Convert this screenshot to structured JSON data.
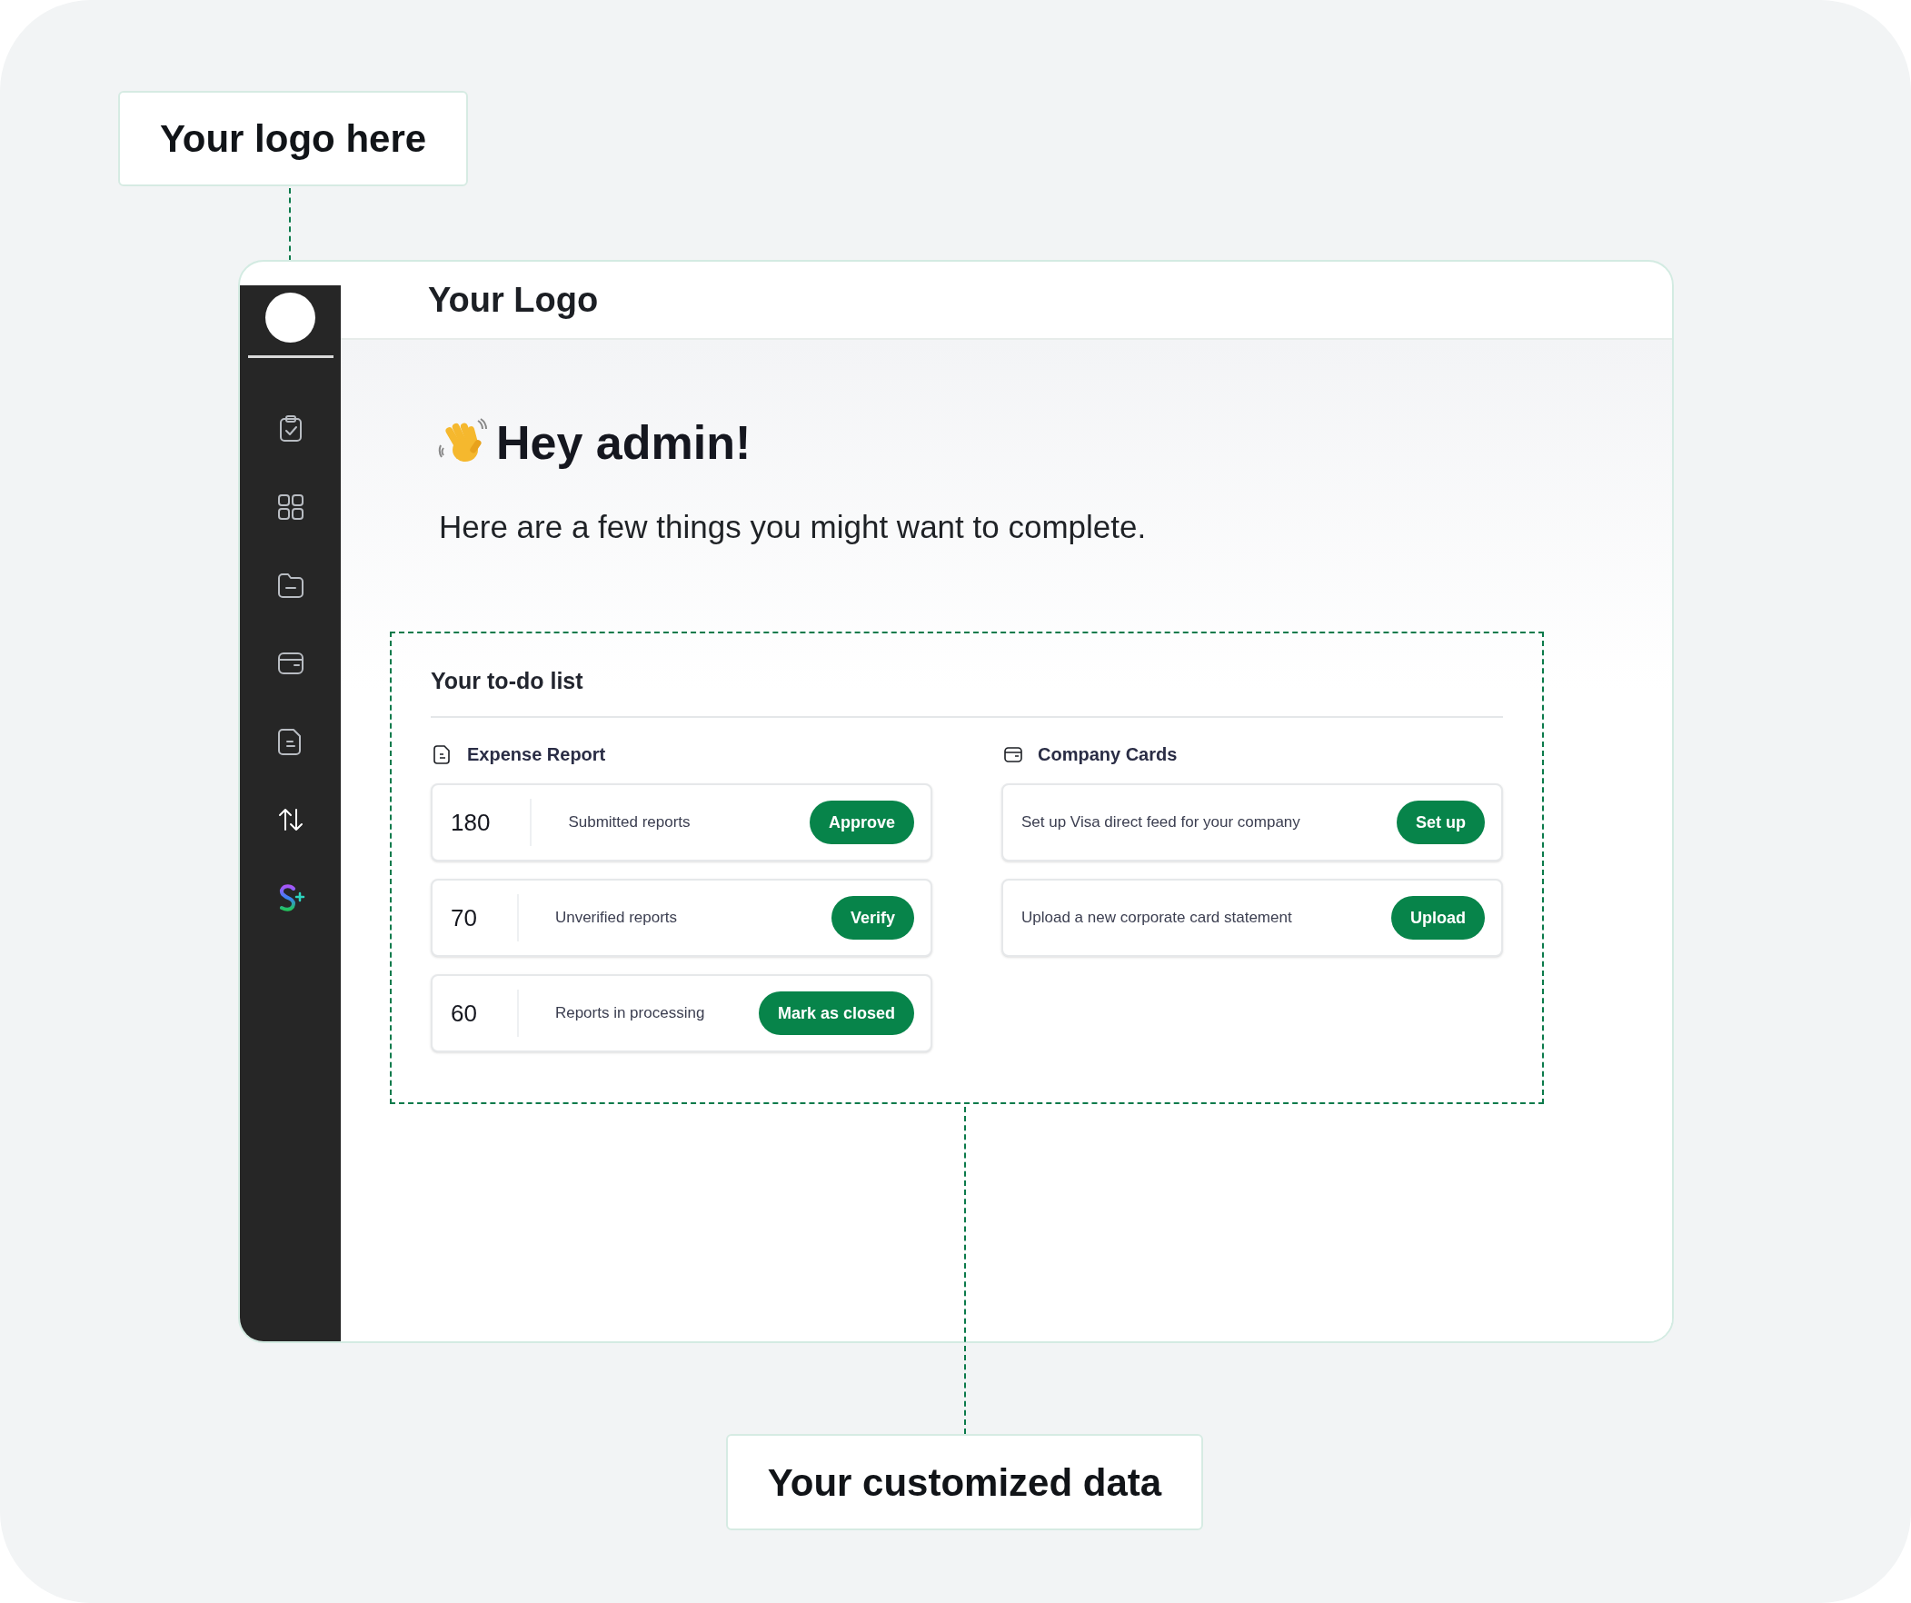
{
  "callouts": [
    {
      "kind": "logo",
      "label": "Your logo here"
    },
    {
      "kind": "data",
      "label": "Your customized data"
    }
  ],
  "header": {
    "logo_text": "Your Logo"
  },
  "greeting": {
    "title": "Hey admin!",
    "subtitle": "Here are a few things you might want to complete."
  },
  "todo": {
    "title": "Your to-do list",
    "sections": [
      {
        "kind": "report",
        "title": "Expense Report",
        "items": [
          {
            "count": "180",
            "label": "Submitted reports",
            "action": "Approve"
          },
          {
            "count": "70",
            "label": "Unverified reports",
            "action": "Verify"
          },
          {
            "count": "60",
            "label": "Reports in processing",
            "action": "Mark as closed"
          }
        ]
      },
      {
        "kind": "card",
        "title": "Company Cards",
        "items": [
          {
            "label": "Set up Visa direct feed for your company",
            "action": "Set up"
          },
          {
            "label": "Upload a new corporate card statement",
            "action": "Upload"
          }
        ]
      }
    ]
  }
}
